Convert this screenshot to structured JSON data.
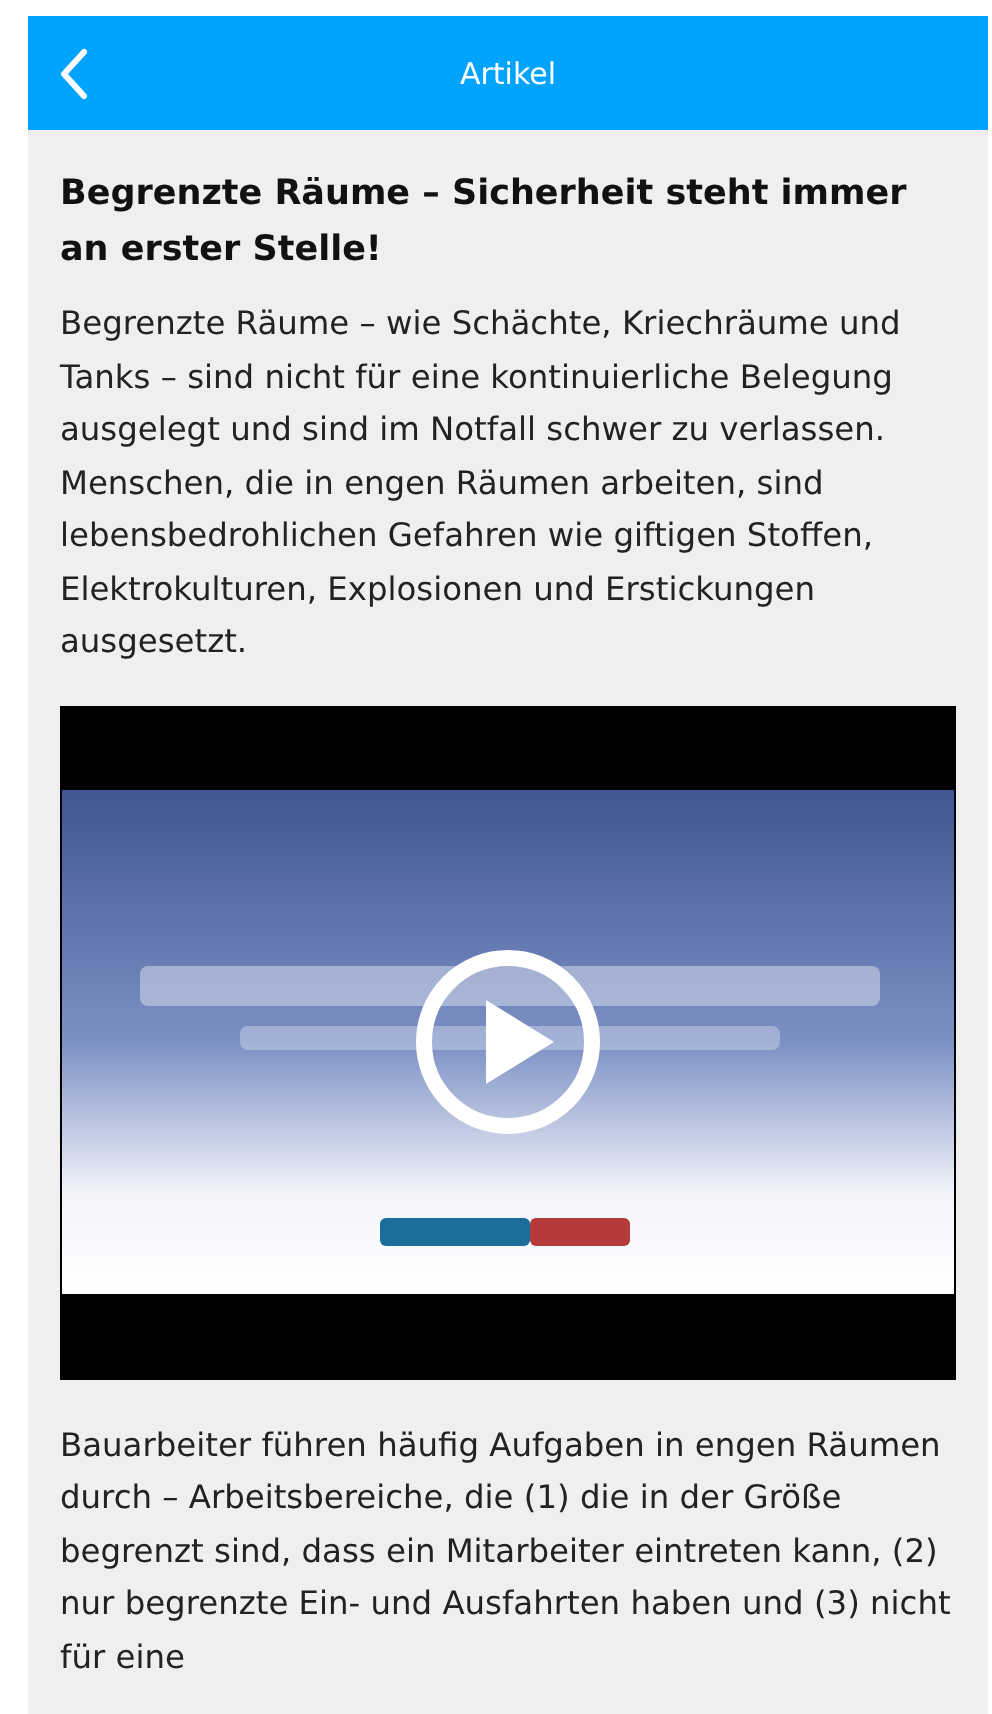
{
  "header": {
    "title": "Artikel"
  },
  "article": {
    "title": "Begrenzte Räume – Sicherheit steht immer an erster Stelle!",
    "intro": "Begrenzte Räume – wie Schächte, Kriechräume und Tanks – sind nicht für eine kontinuierliche Belegung ausgelegt und sind im Notfall schwer zu verlassen. Menschen, die in engen Räumen arbeiten, sind lebensbedrohlichen Gefahren wie giftigen Stoffen, Elektrokulturen, Explosionen und Erstickungen ausgesetzt.",
    "body": "Bauarbeiter führen häufig Aufgaben in engen Räumen durch – Arbeitsbereiche, die (1) die in der Größe begrenzt sind, dass ein Mitarbeiter eintreten kann, (2) nur begrenzte Ein- und Ausfahrten haben und (3) nicht für eine"
  }
}
